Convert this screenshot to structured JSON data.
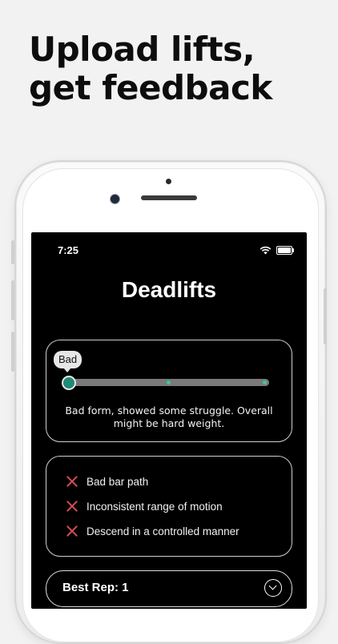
{
  "headline": {
    "line1": "Upload lifts,",
    "line2": "get feedback"
  },
  "status_bar": {
    "time": "7:25",
    "wifi_icon": "wifi-icon",
    "battery_icon": "battery-icon"
  },
  "screen": {
    "title": "Deadlifts",
    "rating": {
      "label": "Bad",
      "level": 0,
      "levels": 3,
      "summary": "Bad form, showed some struggle. Overall might be hard weight."
    },
    "issues": [
      {
        "icon": "x-icon",
        "label": "Bad bar path"
      },
      {
        "icon": "x-icon",
        "label": "Inconsistent range of motion"
      },
      {
        "icon": "x-icon",
        "label": "Descend in a controlled manner"
      }
    ],
    "best_rep": {
      "label": "Best Rep: 1",
      "icon": "chevron-down-icon"
    }
  },
  "colors": {
    "accent": "#1f8a77",
    "dot": "#3cc5a6",
    "error": "#d64c56",
    "background": "#f2f2f2",
    "screen": "#000000"
  }
}
